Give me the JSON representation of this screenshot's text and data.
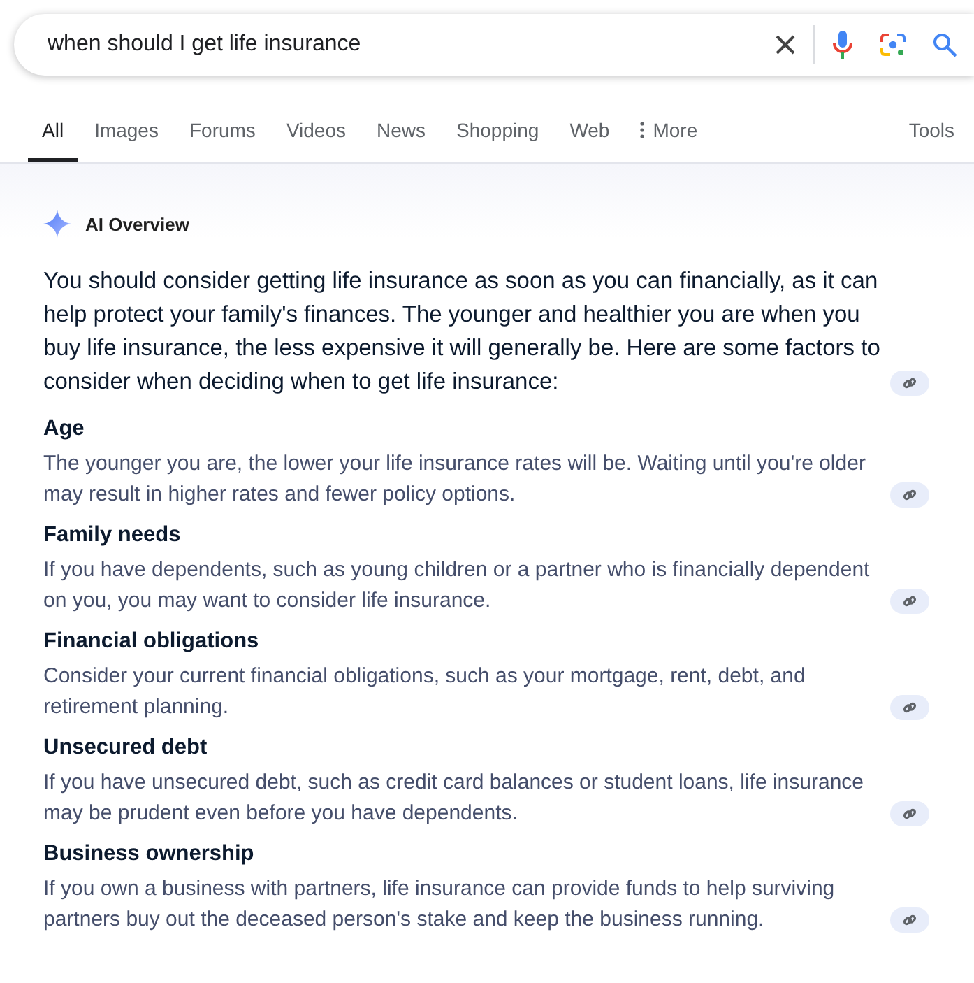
{
  "search": {
    "value": "when should I get life insurance"
  },
  "tabs": [
    {
      "label": "All",
      "selected": true,
      "kind": "tab"
    },
    {
      "label": "Images",
      "selected": false,
      "kind": "tab"
    },
    {
      "label": "Forums",
      "selected": false,
      "kind": "tab"
    },
    {
      "label": "Videos",
      "selected": false,
      "kind": "tab"
    },
    {
      "label": "News",
      "selected": false,
      "kind": "tab"
    },
    {
      "label": "Shopping",
      "selected": false,
      "kind": "tab"
    },
    {
      "label": "Web",
      "selected": false,
      "kind": "tab"
    },
    {
      "label": "More",
      "selected": false,
      "kind": "more"
    }
  ],
  "tools": "Tools",
  "overview": {
    "title": "AI Overview",
    "intro": "You should consider getting life insurance as soon as you can financially, as it can help protect your family's finances. The younger and healthier you are when you buy life insurance, the less expensive it will generally be. Here are some factors to consider when deciding when to get life insurance:",
    "factors": [
      {
        "heading": "Age",
        "text": "The younger you are, the lower your life insurance rates will be. Waiting until you're older may result in higher rates and fewer policy options."
      },
      {
        "heading": "Family needs",
        "text": "If you have dependents, such as young children or a partner who is financially dependent on you, you may want to consider life insurance."
      },
      {
        "heading": "Financial obligations",
        "text": "Consider your current financial obligations, such as your mortgage, rent, debt, and retirement planning."
      },
      {
        "heading": "Unsecured debt",
        "text": "If you have unsecured debt, such as credit card balances or student loans, life insurance may be prudent even before you have dependents."
      },
      {
        "heading": "Business ownership",
        "text": "If you own a business with partners, life insurance can provide funds to help surviving partners buy out the deceased person's stake and keep the business running."
      }
    ]
  }
}
